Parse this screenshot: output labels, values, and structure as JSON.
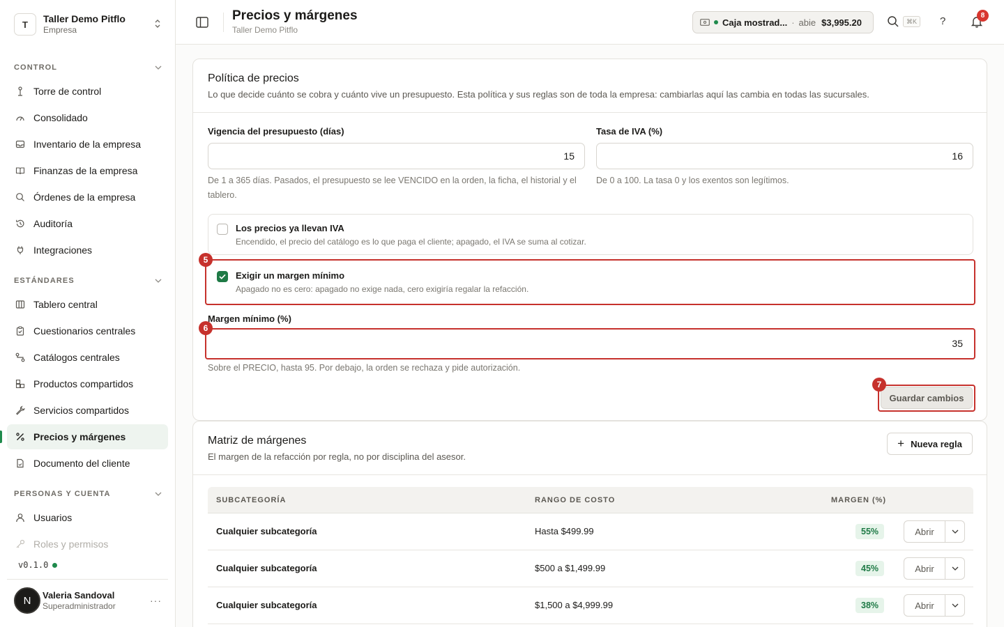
{
  "org": {
    "initial": "T",
    "name": "Taller Demo Pitflo",
    "type": "Empresa"
  },
  "sidebar": {
    "sections": [
      {
        "title": "CONTROL",
        "items": [
          {
            "label": "Torre de control",
            "icon": "tower-icon"
          },
          {
            "label": "Consolidado",
            "icon": "gauge-icon"
          },
          {
            "label": "Inventario de la empresa",
            "icon": "inbox-icon"
          },
          {
            "label": "Finanzas de la empresa",
            "icon": "book-icon"
          },
          {
            "label": "Órdenes de la empresa",
            "icon": "search-icon"
          },
          {
            "label": "Auditoría",
            "icon": "history-icon"
          },
          {
            "label": "Integraciones",
            "icon": "plug-icon"
          }
        ]
      },
      {
        "title": "ESTÁNDARES",
        "items": [
          {
            "label": "Tablero central",
            "icon": "columns-icon"
          },
          {
            "label": "Cuestionarios centrales",
            "icon": "clipboard-icon"
          },
          {
            "label": "Catálogos centrales",
            "icon": "route-icon"
          },
          {
            "label": "Productos compartidos",
            "icon": "boxes-icon"
          },
          {
            "label": "Servicios compartidos",
            "icon": "wrench-icon"
          },
          {
            "label": "Precios y márgenes",
            "icon": "percent-icon"
          },
          {
            "label": "Documento del cliente",
            "icon": "document-icon"
          }
        ]
      },
      {
        "title": "PERSONAS Y CUENTA",
        "items": [
          {
            "label": "Usuarios",
            "icon": "user-icon"
          },
          {
            "label": "Roles y permisos",
            "icon": "key-icon"
          }
        ]
      }
    ],
    "version": "v0.1.0"
  },
  "user": {
    "initial": "N",
    "name": "Valeria Sandoval",
    "role": "Superadministrador",
    "more": "···"
  },
  "header": {
    "title": "Precios y márgenes",
    "subtitle": "Taller Demo Pitflo",
    "register": {
      "name": "Caja mostrad...",
      "sep": "·",
      "state": "abie",
      "amount": "$3,995.20"
    },
    "shortcut": "⌘K",
    "help": "?",
    "notifications": "8"
  },
  "policy": {
    "title": "Política de precios",
    "description": "Lo que decide cuánto se cobra y cuánto vive un presupuesto. Esta política y sus reglas son de toda la empresa: cambiarlas aquí las cambia en todas las sucursales.",
    "validity": {
      "label": "Vigencia del presupuesto (días)",
      "value": "15",
      "help": "De 1 a 365 días. Pasados, el presupuesto se lee VENCIDO en la orden, la ficha, el historial y el tablero."
    },
    "vat": {
      "label": "Tasa de IVA (%)",
      "value": "16",
      "help": "De 0 a 100. La tasa 0 y los exentos son legítimos."
    },
    "prices_include_vat": {
      "title": "Los precios ya llevan IVA",
      "desc": "Encendido, el precio del catálogo es lo que paga el cliente; apagado, el IVA se suma al cotizar.",
      "checked": false
    },
    "require_min_margin": {
      "title": "Exigir un margen mínimo",
      "desc": "Apagado no es cero: apagado no exige nada, cero exigiría regalar la refacción.",
      "checked": true
    },
    "min_margin": {
      "label": "Margen mínimo (%)",
      "value": "35",
      "help": "Sobre el PRECIO, hasta 95. Por debajo, la orden se rechaza y pide autorización."
    },
    "save_label": "Guardar cambios"
  },
  "steps": {
    "five": "5",
    "six": "6",
    "seven": "7"
  },
  "matrix": {
    "title": "Matriz de márgenes",
    "description": "El margen de la refacción por regla, no por disciplina del asesor.",
    "new_rule_label": "Nueva regla",
    "columns": [
      "SUBCATEGORÍA",
      "RANGO DE COSTO",
      "MARGEN (%)"
    ],
    "rows": [
      {
        "subcategory": "Cualquier subcategoría",
        "range": "Hasta $499.99",
        "margin": "55%",
        "action": "Abrir"
      },
      {
        "subcategory": "Cualquier subcategoría",
        "range": "$500 a $1,499.99",
        "margin": "45%",
        "action": "Abrir"
      },
      {
        "subcategory": "Cualquier subcategoría",
        "range": "$1,500 a $4,999.99",
        "margin": "38%",
        "action": "Abrir"
      }
    ]
  },
  "colors": {
    "accent": "#1f7a46",
    "highlight": "#c6312c",
    "badge": "#d8362f"
  }
}
